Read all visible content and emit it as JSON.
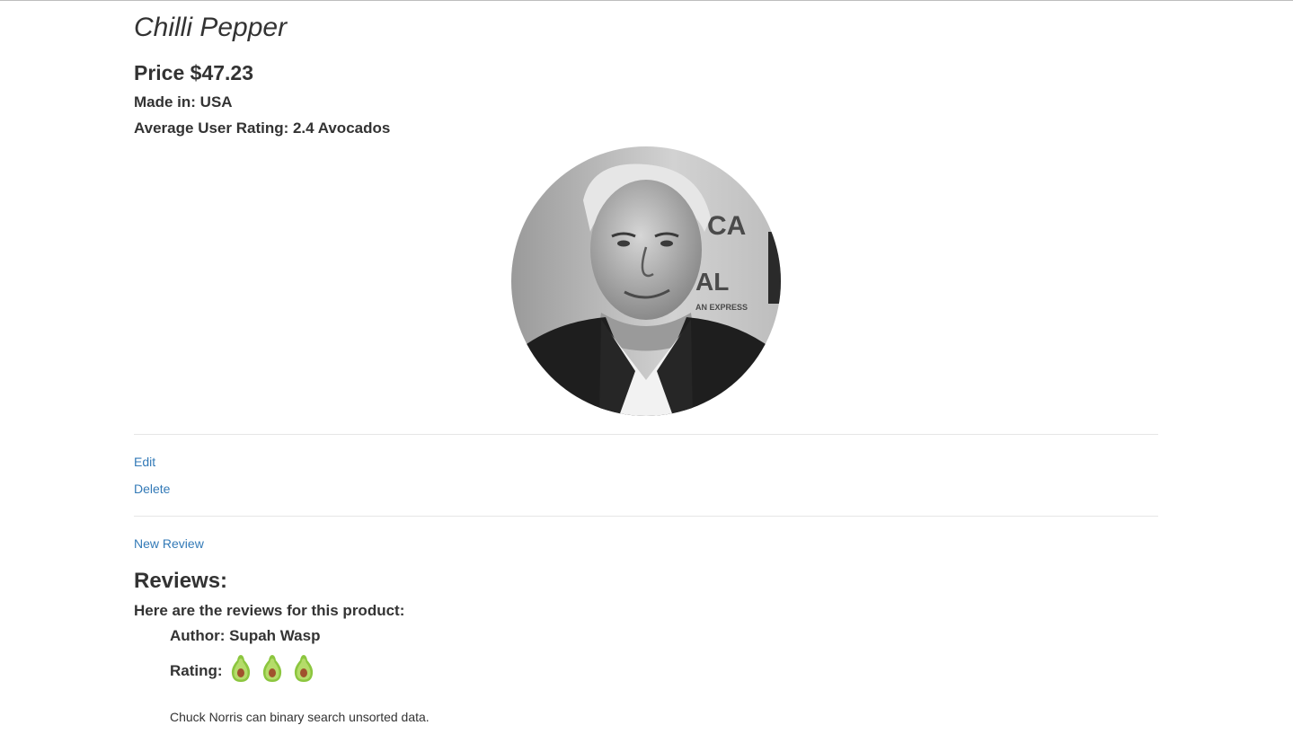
{
  "product": {
    "name": "Chilli Pepper",
    "price": "Price $47.23",
    "made_in": "Made in: USA",
    "average_rating": "Average User Rating: 2.4 Avocados"
  },
  "actions": {
    "edit": "Edit",
    "delete": "Delete",
    "new_review": "New Review"
  },
  "reviews": {
    "heading": "Reviews:",
    "intro": "Here are the reviews for this product:",
    "items": [
      {
        "author": "Author: Supah Wasp",
        "rating_label": "Rating:",
        "rating": 3,
        "rating_icon": "avocado-icon",
        "body": "Chuck Norris can binary search unsorted data."
      }
    ]
  },
  "colors": {
    "link": "#337ab7",
    "text": "#333333",
    "avocado_skin": "#8cc63f",
    "avocado_pit": "#a0522d"
  }
}
